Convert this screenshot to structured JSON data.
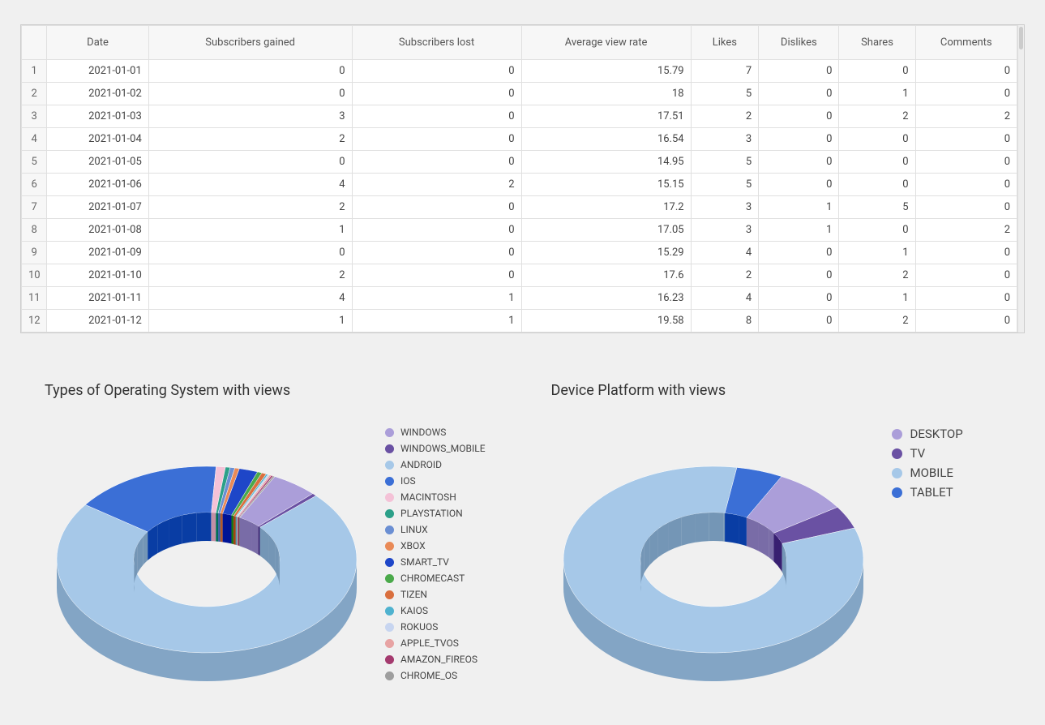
{
  "table": {
    "headers": [
      "Date",
      "Subscribers gained",
      "Subscribers lost",
      "Average view rate",
      "Likes",
      "Dislikes",
      "Shares",
      "Comments"
    ],
    "rows": [
      [
        "2021-01-01",
        "0",
        "0",
        "15.79",
        "7",
        "0",
        "0",
        "0"
      ],
      [
        "2021-01-02",
        "0",
        "0",
        "18",
        "5",
        "0",
        "1",
        "0"
      ],
      [
        "2021-01-03",
        "3",
        "0",
        "17.51",
        "2",
        "0",
        "2",
        "2"
      ],
      [
        "2021-01-04",
        "2",
        "0",
        "16.54",
        "3",
        "0",
        "0",
        "0"
      ],
      [
        "2021-01-05",
        "0",
        "0",
        "14.95",
        "5",
        "0",
        "0",
        "0"
      ],
      [
        "2021-01-06",
        "4",
        "2",
        "15.15",
        "5",
        "0",
        "0",
        "0"
      ],
      [
        "2021-01-07",
        "2",
        "0",
        "17.2",
        "3",
        "1",
        "5",
        "0"
      ],
      [
        "2021-01-08",
        "1",
        "0",
        "17.05",
        "3",
        "1",
        "0",
        "2"
      ],
      [
        "2021-01-09",
        "0",
        "0",
        "15.29",
        "4",
        "0",
        "1",
        "0"
      ],
      [
        "2021-01-10",
        "2",
        "0",
        "17.6",
        "2",
        "0",
        "2",
        "0"
      ],
      [
        "2021-01-11",
        "4",
        "1",
        "16.23",
        "4",
        "0",
        "1",
        "0"
      ],
      [
        "2021-01-12",
        "1",
        "1",
        "19.58",
        "8",
        "0",
        "2",
        "0"
      ]
    ]
  },
  "chart_data": [
    {
      "type": "pie",
      "title": "Types of Operating System with views",
      "series": [
        {
          "name": "WINDOWS",
          "value": 5,
          "color": "#ab9ed9"
        },
        {
          "name": "WINDOWS_MOBILE",
          "value": 0.5,
          "color": "#6a51a3"
        },
        {
          "name": "ANDROID",
          "value": 72,
          "color": "#a6c8e8"
        },
        {
          "name": "IOS",
          "value": 16,
          "color": "#3b6fd6"
        },
        {
          "name": "MACINTOSH",
          "value": 1,
          "color": "#f4c2d7"
        },
        {
          "name": "PLAYSTATION",
          "value": 0.5,
          "color": "#2ca089"
        },
        {
          "name": "LINUX",
          "value": 0.5,
          "color": "#6b8fd3"
        },
        {
          "name": "XBOX",
          "value": 0.5,
          "color": "#e98a57"
        },
        {
          "name": "SMART_TV",
          "value": 2,
          "color": "#1e46c8"
        },
        {
          "name": "CHROMECAST",
          "value": 0.5,
          "color": "#4aa94a"
        },
        {
          "name": "TIZEN",
          "value": 0.5,
          "color": "#d96f3e"
        },
        {
          "name": "KAIOS",
          "value": 0.2,
          "color": "#4fb2cf"
        },
        {
          "name": "ROKUOS",
          "value": 0.2,
          "color": "#c7d5f0"
        },
        {
          "name": "APPLE_TVOS",
          "value": 0.2,
          "color": "#e7a3a3"
        },
        {
          "name": "AMAZON_FIREOS",
          "value": 0.2,
          "color": "#a43a6e"
        },
        {
          "name": "CHROME_OS",
          "value": 0.2,
          "color": "#9e9e9e"
        }
      ]
    },
    {
      "type": "pie",
      "title": "Device Platform with views",
      "series": [
        {
          "name": "DESKTOP",
          "value": 8,
          "color": "#ab9ed9"
        },
        {
          "name": "TV",
          "value": 4,
          "color": "#6a51a3"
        },
        {
          "name": "MOBILE",
          "value": 83,
          "color": "#a6c8e8"
        },
        {
          "name": "TABLET",
          "value": 5,
          "color": "#3b6fd6"
        }
      ]
    }
  ]
}
